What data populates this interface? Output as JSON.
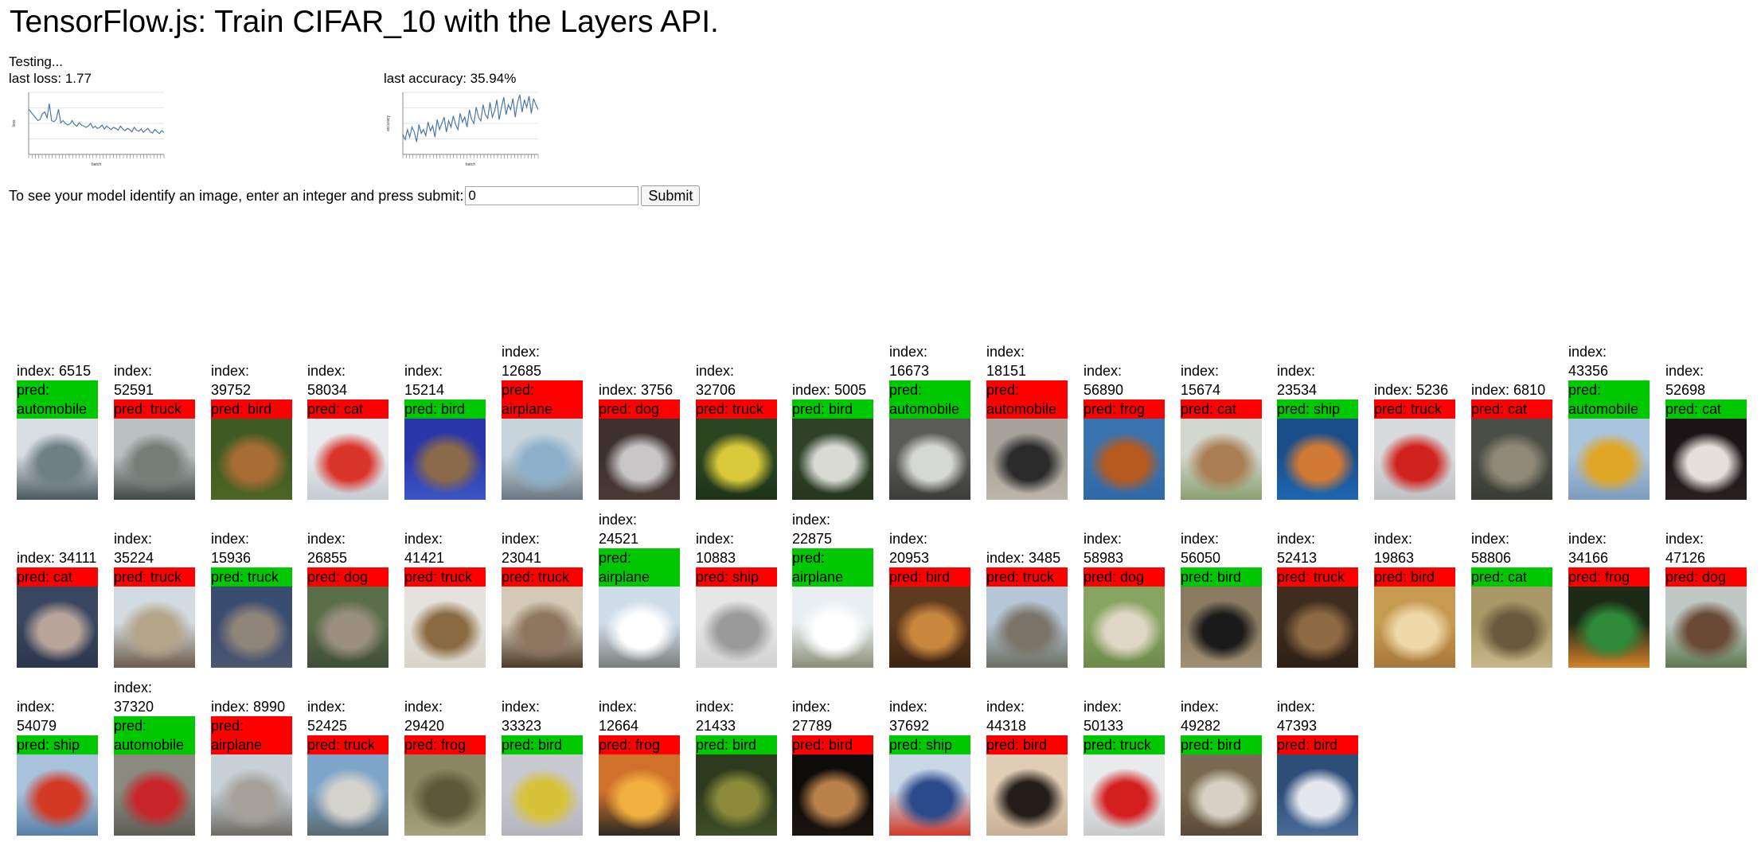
{
  "page": {
    "title": "TensorFlow.js: Train CIFAR_10 with the Layers API."
  },
  "status": {
    "testing_text": "Testing...",
    "loss_text": "last loss: 1.77",
    "accuracy_text": "last accuracy: 35.94%"
  },
  "loss_chart": {
    "type": "line",
    "ylabel": "loss",
    "xlabel": "batch",
    "series": [
      2.2,
      2.15,
      2.1,
      2.05,
      2.0,
      2.02,
      2.12,
      2.15,
      2.05,
      2.3,
      2.0,
      1.98,
      2.02,
      2.2,
      1.96,
      2.0,
      1.95,
      1.92,
      1.94,
      2.0,
      1.93,
      1.9,
      1.96,
      1.92,
      1.9,
      1.88,
      1.9,
      1.95,
      1.87,
      1.9,
      1.86,
      1.88,
      1.92,
      1.85,
      1.9,
      1.87,
      1.84,
      1.88,
      1.86,
      1.83,
      1.9,
      1.85,
      1.82,
      1.86,
      1.84,
      1.8,
      1.88,
      1.83,
      1.81,
      1.85,
      1.79,
      1.83,
      1.86,
      1.8,
      1.78,
      1.84,
      1.8,
      1.77,
      1.82,
      1.79
    ]
  },
  "accuracy_chart": {
    "type": "line",
    "ylabel": "accuracy",
    "xlabel": "batch",
    "series": [
      0.16,
      0.12,
      0.2,
      0.14,
      0.22,
      0.18,
      0.1,
      0.24,
      0.17,
      0.2,
      0.15,
      0.26,
      0.19,
      0.23,
      0.14,
      0.28,
      0.2,
      0.25,
      0.3,
      0.18,
      0.27,
      0.22,
      0.31,
      0.24,
      0.2,
      0.33,
      0.26,
      0.3,
      0.22,
      0.36,
      0.28,
      0.25,
      0.38,
      0.3,
      0.27,
      0.4,
      0.32,
      0.29,
      0.42,
      0.3,
      0.35,
      0.44,
      0.28,
      0.38,
      0.46,
      0.32,
      0.4,
      0.36,
      0.45,
      0.3,
      0.42,
      0.48,
      0.34,
      0.44,
      0.38,
      0.47,
      0.33,
      0.45,
      0.4,
      0.36
    ]
  },
  "predict": {
    "prompt": "To see your model identify an image, enter an integer and press submit:",
    "input_value": "0",
    "submit_label": "Submit"
  },
  "samples": [
    {
      "index": "index: 6515",
      "pred": "pred: automobile",
      "correct": true,
      "colors": [
        "#d8dde1",
        "#6e7f85",
        "#49595f"
      ]
    },
    {
      "index": "index: 52591",
      "pred": "pred: truck",
      "correct": false,
      "colors": [
        "#b9c2c2",
        "#757f78",
        "#3f4a45"
      ]
    },
    {
      "index": "index: 39752",
      "pred": "pred: bird",
      "correct": false,
      "colors": [
        "#3f5a22",
        "#a86c35",
        "#4d6624"
      ]
    },
    {
      "index": "index: 58034",
      "pred": "pred: cat",
      "correct": false,
      "colors": [
        "#e8eaee",
        "#d9352a",
        "#c7cbd2"
      ]
    },
    {
      "index": "index: 15214",
      "pred": "pred: bird",
      "correct": true,
      "colors": [
        "#2b36a8",
        "#8a6a4a",
        "#3d56c4"
      ]
    },
    {
      "index": "index: 12685",
      "pred": "pred: airplane",
      "correct": false,
      "colors": [
        "#c8d4dc",
        "#8cb0c9",
        "#6a7780"
      ]
    },
    {
      "index": "index: 3756",
      "pred": "pred: dog",
      "correct": false,
      "colors": [
        "#3d302e",
        "#c9c6c8",
        "#4a3a36"
      ]
    },
    {
      "index": "index: 32706",
      "pred": "pred: truck",
      "correct": false,
      "colors": [
        "#2a4520",
        "#d8c83a",
        "#1e331a"
      ]
    },
    {
      "index": "index: 5005",
      "pred": "pred: bird",
      "correct": true,
      "colors": [
        "#2f4228",
        "#d9dad4",
        "#27361f"
      ]
    },
    {
      "index": "index: 16673",
      "pred": "pred: automobile",
      "correct": true,
      "colors": [
        "#5a5a58",
        "#d6d8d6",
        "#3c3d3a"
      ]
    },
    {
      "index": "index: 18151",
      "pred": "pred: automobile",
      "correct": false,
      "colors": [
        "#a7a39a",
        "#2b2b2c",
        "#bdb6aa"
      ]
    },
    {
      "index": "index: 56890",
      "pred": "pred: frog",
      "correct": false,
      "colors": [
        "#3a74b0",
        "#b65a1f",
        "#3068a6"
      ]
    },
    {
      "index": "index: 15674",
      "pred": "pred: cat",
      "correct": false,
      "colors": [
        "#d3d6cd",
        "#a87e52",
        "#8aa070"
      ]
    },
    {
      "index": "index: 23534",
      "pred": "pred: ship",
      "correct": true,
      "colors": [
        "#1b4f8a",
        "#d07a36",
        "#1e66b0"
      ]
    },
    {
      "index": "index: 5236",
      "pred": "pred: truck",
      "correct": false,
      "colors": [
        "#d8dadd",
        "#d1231d",
        "#bfc2c4"
      ]
    },
    {
      "index": "index: 6810",
      "pred": "pred: cat",
      "correct": false,
      "colors": [
        "#4b4e44",
        "#8f8a78",
        "#3a3d34"
      ]
    },
    {
      "index": "index: 43356",
      "pred": "pred: automobile",
      "correct": true,
      "colors": [
        "#aac4de",
        "#e0a626",
        "#7c9cbd"
      ]
    },
    {
      "index": "index: 52698",
      "pred": "pred: cat",
      "correct": true,
      "colors": [
        "#1a1416",
        "#e6e0dc",
        "#2a2022"
      ]
    },
    {
      "index": "index: 34111",
      "pred": "pred: cat",
      "correct": false,
      "colors": [
        "#3a4760",
        "#b9a49a",
        "#2c364d"
      ]
    },
    {
      "index": "index: 35224",
      "pred": "pred: truck",
      "correct": false,
      "colors": [
        "#d2dbe0",
        "#b4a48a",
        "#6d5a48"
      ]
    },
    {
      "index": "index: 15936",
      "pred": "pred: truck",
      "correct": true,
      "colors": [
        "#3a4c70",
        "#8e8478",
        "#4c5770"
      ]
    },
    {
      "index": "index: 26855",
      "pred": "pred: dog",
      "correct": false,
      "colors": [
        "#5b6e4a",
        "#9b8f80",
        "#3f4d36"
      ]
    },
    {
      "index": "index: 41421",
      "pred": "pred: truck",
      "correct": false,
      "colors": [
        "#e4e2da",
        "#8a6a40",
        "#d8d4c8"
      ]
    },
    {
      "index": "index: 23041",
      "pred": "pred: truck",
      "correct": false,
      "colors": [
        "#d4c9b6",
        "#8e7660",
        "#4c3a26"
      ]
    },
    {
      "index": "index: 24521",
      "pred": "pred: airplane",
      "correct": true,
      "colors": [
        "#cfdcea",
        "#ffffff",
        "#7a7f7c"
      ]
    },
    {
      "index": "index: 10883",
      "pred": "pred: ship",
      "correct": false,
      "colors": [
        "#e6e6e6",
        "#9a9a9a",
        "#d2d2d2"
      ]
    },
    {
      "index": "index: 22875",
      "pred": "pred: airplane",
      "correct": true,
      "colors": [
        "#e9eef2",
        "#ffffff",
        "#8a8e76"
      ]
    },
    {
      "index": "index: 20953",
      "pred": "pred: bird",
      "correct": false,
      "colors": [
        "#5e3a1e",
        "#c9873d",
        "#3b2412"
      ]
    },
    {
      "index": "index: 3485",
      "pred": "pred: truck",
      "correct": false,
      "colors": [
        "#b5c7d6",
        "#7b7468",
        "#6b6e62"
      ]
    },
    {
      "index": "index: 58983",
      "pred": "pred: dog",
      "correct": false,
      "colors": [
        "#87a560",
        "#e0d6c6",
        "#6c8a48"
      ]
    },
    {
      "index": "index: 56050",
      "pred": "pred: bird",
      "correct": true,
      "colors": [
        "#8a7a62",
        "#1a1a1a",
        "#a28f74"
      ]
    },
    {
      "index": "index: 52413",
      "pred": "pred: truck",
      "correct": false,
      "colors": [
        "#3e2c1e",
        "#8e6a44",
        "#2e2016"
      ]
    },
    {
      "index": "index: 19863",
      "pred": "pred: bird",
      "correct": false,
      "colors": [
        "#c79a52",
        "#efd9a8",
        "#a8783a"
      ]
    },
    {
      "index": "index: 58806",
      "pred": "pred: cat",
      "correct": true,
      "colors": [
        "#a89868",
        "#6a5a3c",
        "#c8b68a"
      ]
    },
    {
      "index": "index: 34166",
      "pred": "pred: frog",
      "correct": false,
      "colors": [
        "#1c2a16",
        "#2f8a3a",
        "#d4822a"
      ]
    },
    {
      "index": "index: 47126",
      "pred": "pred: dog",
      "correct": false,
      "colors": [
        "#bfc8c4",
        "#6a4a36",
        "#5e7a50"
      ]
    },
    {
      "index": "index: 54079",
      "pred": "pred: ship",
      "correct": true,
      "colors": [
        "#a8c2dc",
        "#d23a26",
        "#5a7fa8"
      ]
    },
    {
      "index": "index: 37320",
      "pred": "pred: automobile",
      "correct": true,
      "colors": [
        "#8a8a7e",
        "#c8262a",
        "#5e5e56"
      ]
    },
    {
      "index": "index: 8990",
      "pred": "pred: airplane",
      "correct": false,
      "colors": [
        "#c8d0d8",
        "#a6a29a",
        "#6e6a64"
      ]
    },
    {
      "index": "index: 52425",
      "pred": "pred: truck",
      "correct": false,
      "colors": [
        "#7fa6c8",
        "#d4d2cc",
        "#5a6a74"
      ]
    },
    {
      "index": "index: 29420",
      "pred": "pred: frog",
      "correct": false,
      "colors": [
        "#8a8660",
        "#5e5838",
        "#a6a27c"
      ]
    },
    {
      "index": "index: 33323",
      "pred": "pred: bird",
      "correct": true,
      "colors": [
        "#c8c8d0",
        "#d8c23a",
        "#b4b4bc"
      ]
    },
    {
      "index": "index: 12664",
      "pred": "pred: frog",
      "correct": false,
      "colors": [
        "#d0702a",
        "#f2b040",
        "#2a2a22"
      ]
    },
    {
      "index": "index: 21433",
      "pred": "pred: bird",
      "correct": true,
      "colors": [
        "#2e3a1e",
        "#8a8a3a",
        "#3e4e26"
      ]
    },
    {
      "index": "index: 27789",
      "pred": "pred: bird",
      "correct": false,
      "colors": [
        "#0e0c0a",
        "#b8804a",
        "#1a1410"
      ]
    },
    {
      "index": "index: 37692",
      "pred": "pred: ship",
      "correct": true,
      "colors": [
        "#c8d6e6",
        "#2a4a8a",
        "#d23a2a"
      ]
    },
    {
      "index": "index: 44318",
      "pred": "pred: bird",
      "correct": false,
      "colors": [
        "#e0cdb6",
        "#241c18",
        "#c8b096"
      ]
    },
    {
      "index": "index: 50133",
      "pred": "pred: truck",
      "correct": true,
      "colors": [
        "#e8eaec",
        "#d41f1f",
        "#c8cacc"
      ]
    },
    {
      "index": "index: 49282",
      "pred": "pred: bird",
      "correct": true,
      "colors": [
        "#7a6a52",
        "#d8d0c2",
        "#5a4a36"
      ]
    },
    {
      "index": "index: 47393",
      "pred": "pred: bird",
      "correct": false,
      "colors": [
        "#2e4e7a",
        "#e4e8ee",
        "#4a6c96"
      ]
    }
  ]
}
